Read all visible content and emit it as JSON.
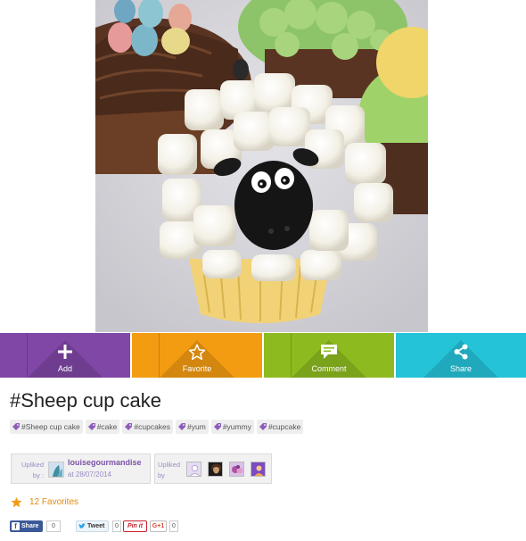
{
  "actions": [
    {
      "label": "Add",
      "icon": "plus-icon",
      "color": "#8047a6"
    },
    {
      "label": "Favorite",
      "icon": "star-outline-icon",
      "color": "#f39c12"
    },
    {
      "label": "Comment",
      "icon": "speech-bubble-icon",
      "color": "#8dbb1f"
    },
    {
      "label": "Share",
      "icon": "share-icon",
      "color": "#25c3d8"
    }
  ],
  "post": {
    "title": "#Sheep cup cake",
    "tags": [
      "#Sheep cup cake",
      "#cake",
      "#cupcakes",
      "#yum",
      "#yummy",
      "#cupcake"
    ]
  },
  "uplike": {
    "uploader_label": "Upliked by :",
    "username": "louisegourmandise",
    "date": "at 28/07/2014",
    "others_label": "Upliked by"
  },
  "favorites": {
    "text": "12 Favorites",
    "icon": "star-icon",
    "color": "#f39c12"
  },
  "share": {
    "facebook_label": "Share",
    "facebook_count": "0",
    "tweet_label": "Tweet",
    "tweet_count": "0",
    "pinit_label": "Pin it",
    "pinit_count": "0",
    "gplus_label": "G+1",
    "gplus_count": "0"
  }
}
